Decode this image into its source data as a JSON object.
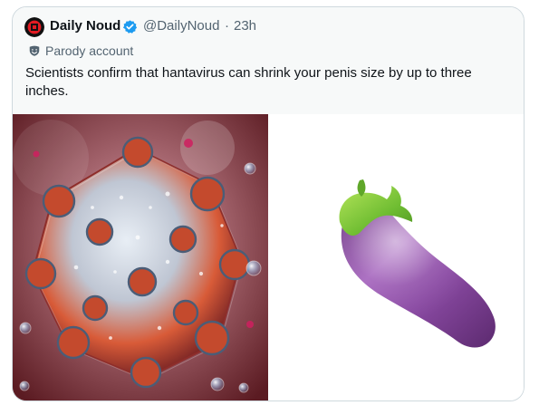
{
  "tweet": {
    "display_name": "Daily Noud",
    "handle": "@DailyNoud",
    "separator": "·",
    "time": "23h",
    "label": "Parody account",
    "text": "Scientists confirm that hantavirus can shrink your penis size by up to three inches.",
    "verified_color": "#1d9bf0"
  },
  "media": {
    "left_icon": "virus-image",
    "right_icon": "eggplant-image"
  }
}
